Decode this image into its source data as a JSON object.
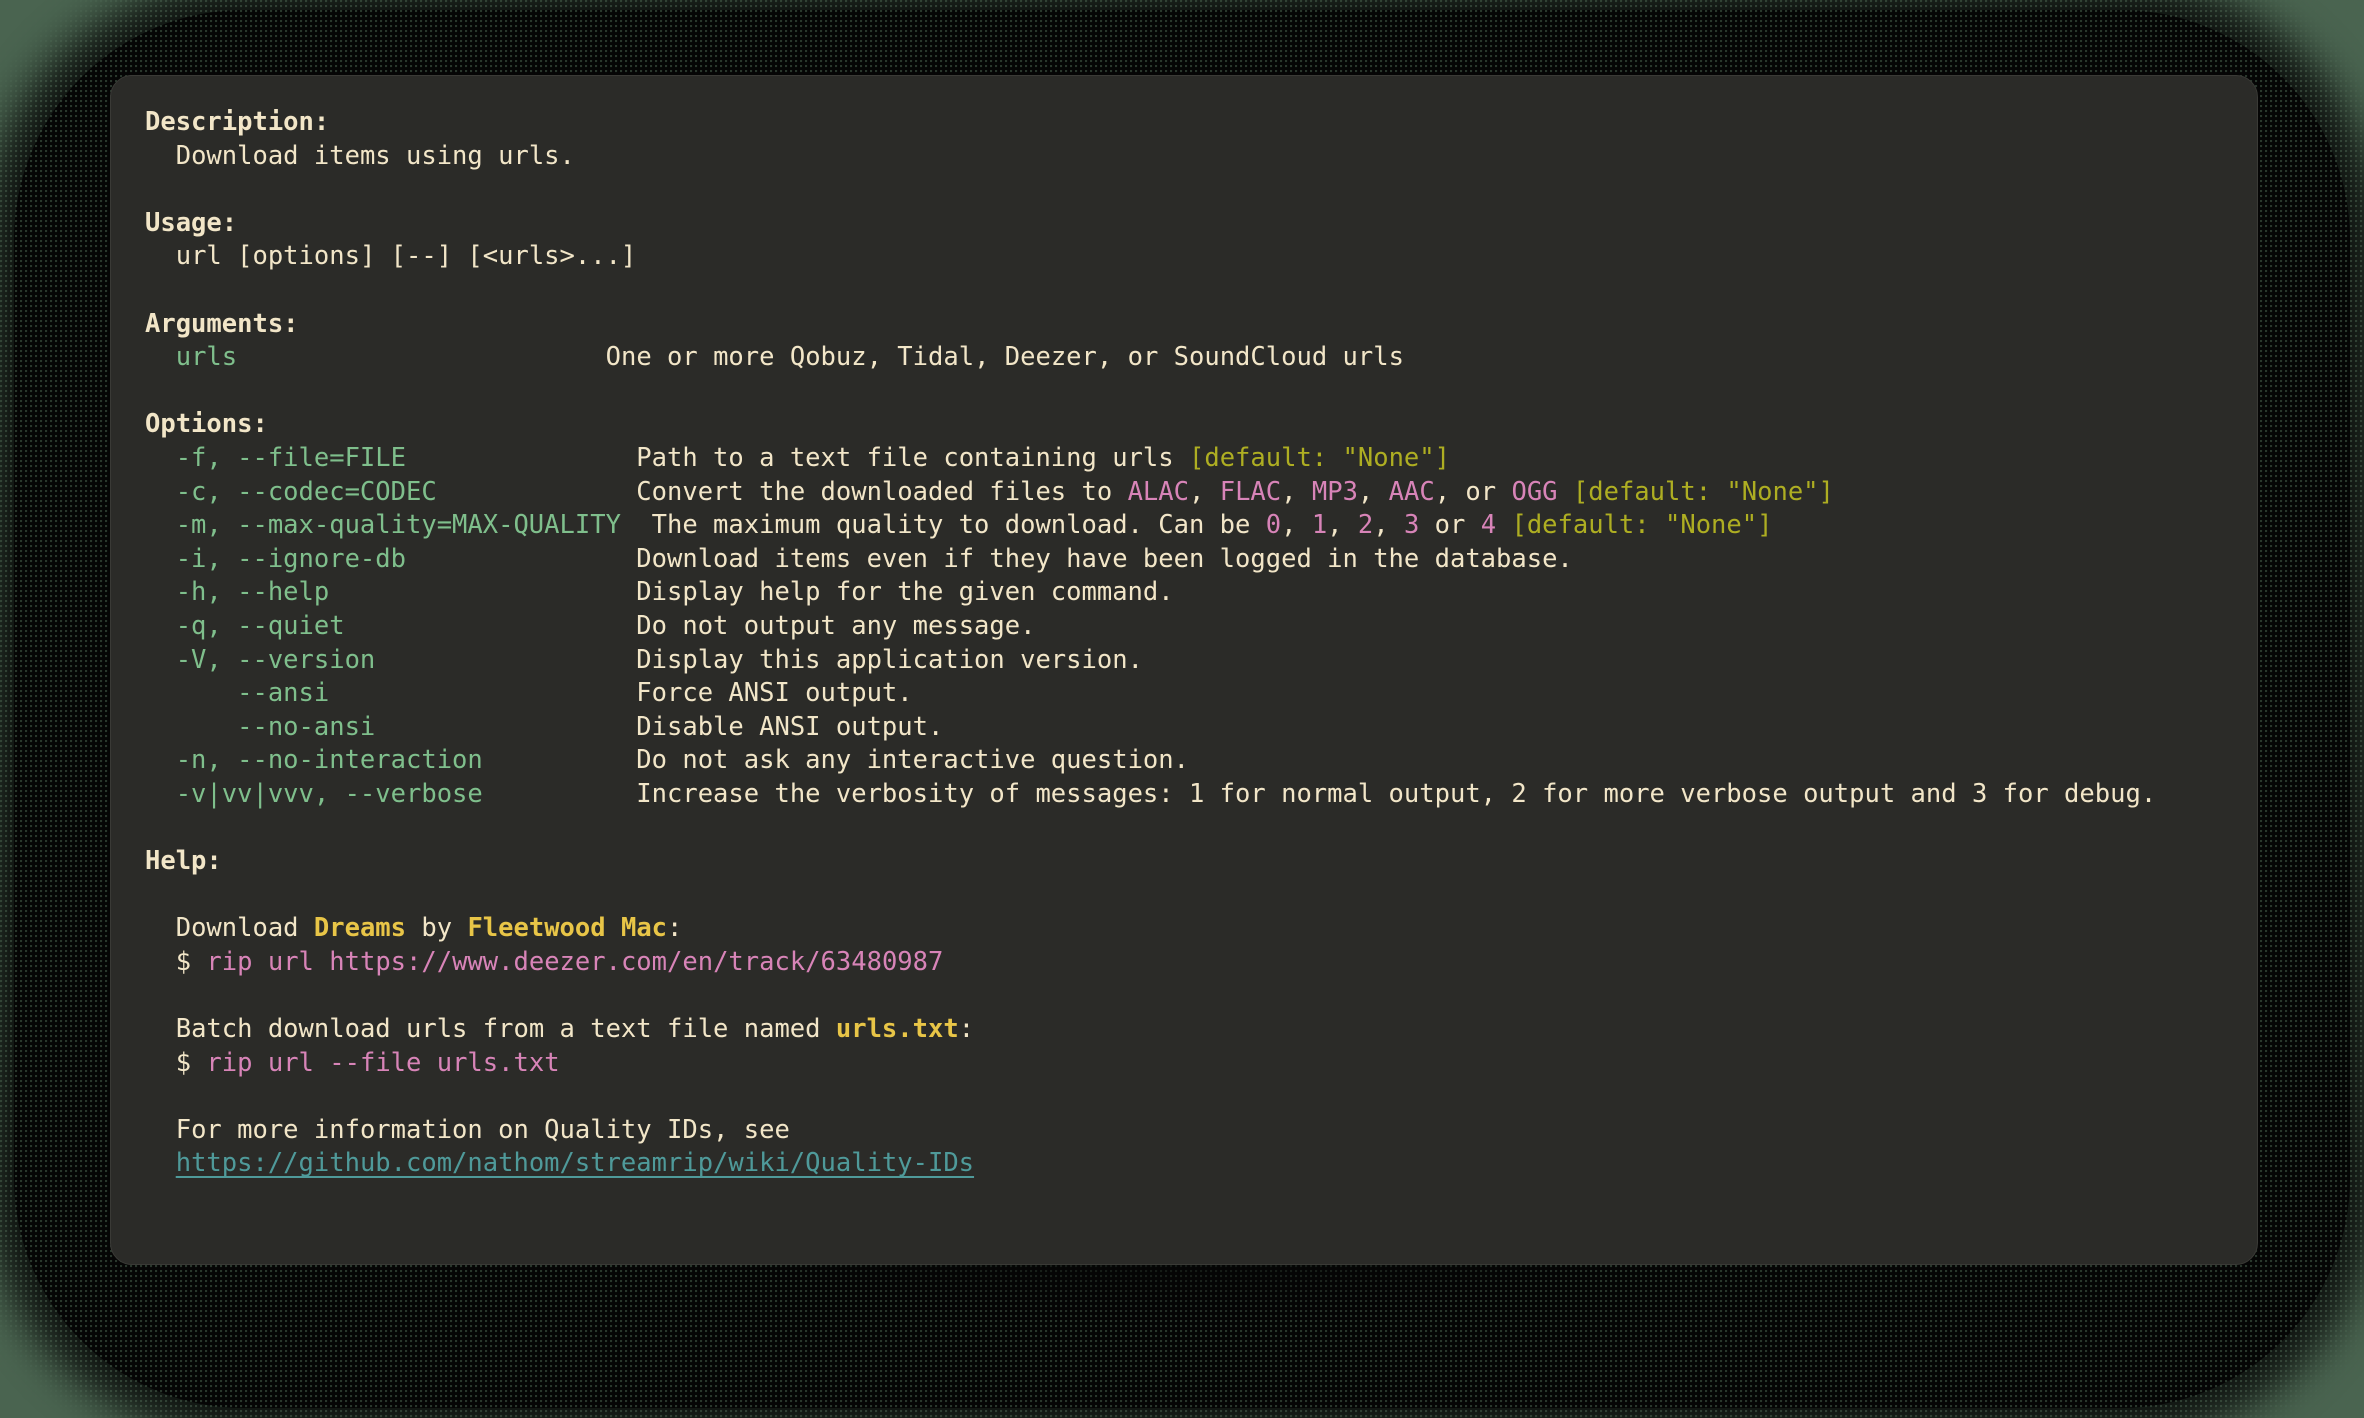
{
  "window": {
    "background_color": "#4a6450",
    "panel_color": "#2b2b28",
    "backdrop_color": "#050505"
  },
  "colors": {
    "text": "#f2e6c8",
    "flag": "#7fbf8c",
    "default": "#aeae22",
    "value": "#d884b8",
    "bold_yellow": "#e8c547",
    "link": "#4f9a9a"
  },
  "sections": {
    "description_heading": "Description:",
    "description_body": "Download items using urls.",
    "usage_heading": "Usage:",
    "usage_body": "url [options] [--] [<urls>...]",
    "arguments_heading": "Arguments:",
    "options_heading": "Options:",
    "help_heading": "Help:"
  },
  "arguments": [
    {
      "name": "urls",
      "description": "One or more Qobuz, Tidal, Deezer, or SoundCloud urls"
    }
  ],
  "options": [
    {
      "flag": "-f, --file=FILE",
      "desc_pre": "Path to a text file containing urls ",
      "values": [],
      "default": "[default: \"None\"]",
      "desc_post": ""
    },
    {
      "flag": "-c, --codec=CODEC",
      "desc_pre": "Convert the downloaded files to ",
      "values": [
        "ALAC",
        "FLAC",
        "MP3",
        "AAC",
        "OGG"
      ],
      "default": "[default: \"None\"]",
      "desc_post": ""
    },
    {
      "flag": "-m, --max-quality=MAX-QUALITY",
      "desc_pre": "The maximum quality to download. Can be ",
      "values": [
        "0",
        "1",
        "2",
        "3",
        "4"
      ],
      "default": "[default: \"None\"]",
      "desc_post": ""
    },
    {
      "flag": "-i, --ignore-db",
      "desc_pre": "Download items even if they have been logged in the database.",
      "values": [],
      "default": "",
      "desc_post": ""
    },
    {
      "flag": "-h, --help",
      "desc_pre": "Display help for the given command.",
      "values": [],
      "default": "",
      "desc_post": ""
    },
    {
      "flag": "-q, --quiet",
      "desc_pre": "Do not output any message.",
      "values": [],
      "default": "",
      "desc_post": ""
    },
    {
      "flag": "-V, --version",
      "desc_pre": "Display this application version.",
      "values": [],
      "default": "",
      "desc_post": ""
    },
    {
      "flag": "    --ansi",
      "desc_pre": "Force ANSI output.",
      "values": [],
      "default": "",
      "desc_post": ""
    },
    {
      "flag": "    --no-ansi",
      "desc_pre": "Disable ANSI output.",
      "values": [],
      "default": "",
      "desc_post": ""
    },
    {
      "flag": "-n, --no-interaction",
      "desc_pre": "Do not ask any interactive question.",
      "values": [],
      "default": "",
      "desc_post": ""
    },
    {
      "flag": "-v|vv|vvv, --verbose",
      "desc_pre": "Increase the verbosity of messages: 1 for normal output, 2 for more verbose output and 3 for debug.",
      "values": [],
      "default": "",
      "desc_post": ""
    }
  ],
  "help": {
    "example1": {
      "text_before": "Download ",
      "bold1": "Dreams",
      "text_mid": " by ",
      "bold2": "Fleetwood Mac",
      "text_after": ":",
      "prompt": "$ ",
      "command": "rip url https://www.deezer.com/en/track/63480987"
    },
    "example2": {
      "text_before": "Batch download urls from a text file named ",
      "bold1": "urls.txt",
      "text_after": ":",
      "prompt": "$ ",
      "command": "rip url --file urls.txt"
    },
    "footer": {
      "text": "For more information on Quality IDs, see",
      "link": "https://github.com/nathom/streamrip/wiki/Quality-IDs"
    }
  }
}
